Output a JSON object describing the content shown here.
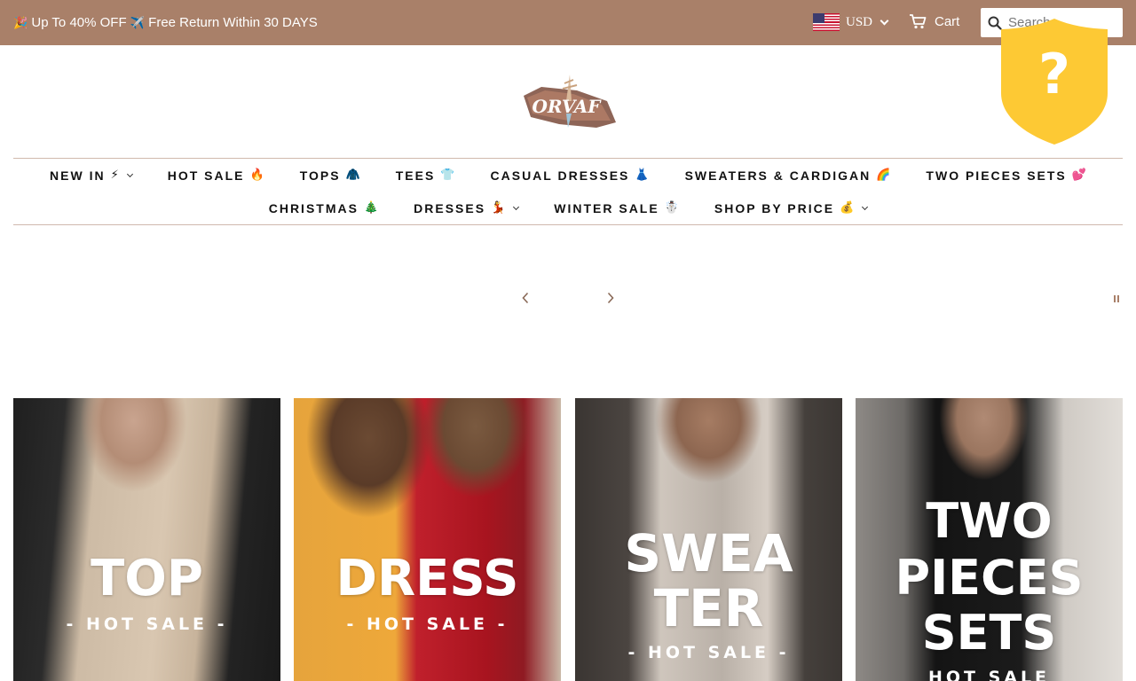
{
  "announcement": {
    "emoji_start": "🎉",
    "offer": "Up To 40% OFF",
    "emoji_mid": "✈️",
    "returns": "Free Return Within 30 DAYS"
  },
  "header": {
    "currency": "USD",
    "cart_label": "Cart",
    "search_placeholder": "Search"
  },
  "logo": {
    "text": "ORVAF"
  },
  "shield_badge": {
    "symbol": "?"
  },
  "nav": {
    "row1": [
      {
        "label": "NEW IN",
        "emoji": "⚡",
        "dropdown": true
      },
      {
        "label": "HOT SALE",
        "emoji": "🔥",
        "dropdown": false
      },
      {
        "label": "TOPS",
        "emoji": "🧥",
        "dropdown": false
      },
      {
        "label": "TEES",
        "emoji": "👕",
        "dropdown": false
      },
      {
        "label": "CASUAL DRESSES",
        "emoji": "👗",
        "dropdown": false
      },
      {
        "label": "SWEATERS & CARDIGAN",
        "emoji": "🌈",
        "dropdown": false
      },
      {
        "label": "TWO PIECES SETS",
        "emoji": "💕",
        "dropdown": false
      }
    ],
    "row2": [
      {
        "label": "CHRISTMAS",
        "emoji": "🎄",
        "dropdown": false
      },
      {
        "label": "DRESSES",
        "emoji": "💃",
        "dropdown": true
      },
      {
        "label": "WINTER SALE",
        "emoji": "☃️",
        "dropdown": false
      },
      {
        "label": "SHOP BY PRICE",
        "emoji": "💰",
        "dropdown": true
      }
    ]
  },
  "tiles": [
    {
      "lines": [
        "TOP"
      ],
      "tag": "- HOT SALE -"
    },
    {
      "lines": [
        "DRESS"
      ],
      "tag": "- HOT SALE -"
    },
    {
      "lines": [
        "SWEA",
        "TER"
      ],
      "tag": "- HOT SALE -"
    },
    {
      "lines": [
        "TWO",
        "PIECES",
        "SETS"
      ],
      "tag": "HOT SALE"
    }
  ],
  "colors": {
    "topbar": "#a98069",
    "shield": "#fdc934",
    "nav_text": "#111111"
  },
  "icons": {
    "cart": "cart-icon",
    "search": "search-icon",
    "shield": "shield-icon",
    "prev": "chevron-left-icon",
    "next": "chevron-right-icon",
    "pause": "pause-icon"
  }
}
